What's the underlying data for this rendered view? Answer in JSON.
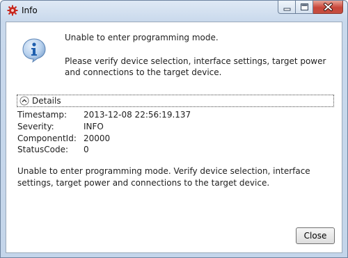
{
  "window": {
    "title": "Info",
    "app_icon": "red-gear-icon"
  },
  "caption": {
    "minimize_icon": "minimize-icon",
    "maximize_icon": "maximize-icon",
    "close_icon": "close-icon"
  },
  "message": {
    "icon": "info-icon",
    "headline": "Unable to enter programming mode.",
    "detail": "Please verify device selection, interface settings, target power and connections to the target device."
  },
  "details": {
    "toggle_label": "Details",
    "rows": [
      {
        "key": "Timestamp:",
        "value": "2013-12-08 22:56:19.137"
      },
      {
        "key": "Severity:",
        "value": "INFO"
      },
      {
        "key": "ComponentId:",
        "value": "20000"
      },
      {
        "key": "StatusCode:",
        "value": "0"
      }
    ],
    "full_message": "Unable to enter programming mode. Verify device selection, interface settings, target power and connections to the target device."
  },
  "buttons": {
    "close_label": "Close"
  },
  "colors": {
    "title_gradient_top": "#dfe9f5",
    "close_button_red": "#c9463a",
    "info_icon_blue": "#2a6fbf"
  }
}
